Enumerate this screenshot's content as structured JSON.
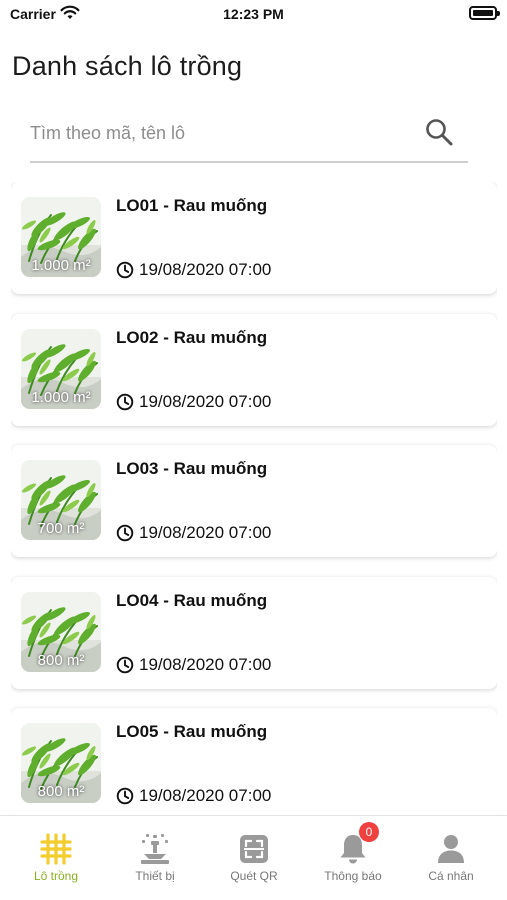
{
  "status_bar": {
    "carrier": "Carrier",
    "time": "12:23 PM"
  },
  "page": {
    "title": "Danh sách lô trồng"
  },
  "search": {
    "placeholder": "Tìm theo mã, tên lô",
    "value": ""
  },
  "plots": [
    {
      "title": "LO01 - Rau muống",
      "area": "1.000 m²",
      "date": "19/08/2020 07:00"
    },
    {
      "title": "LO02 - Rau muống",
      "area": "1.000 m²",
      "date": "19/08/2020 07:00"
    },
    {
      "title": "LO03 - Rau muống",
      "area": "700 m²",
      "date": "19/08/2020 07:00"
    },
    {
      "title": "LO04 - Rau muống",
      "area": "800 m²",
      "date": "19/08/2020 07:00"
    },
    {
      "title": "LO05 - Rau muống",
      "area": "800 m²",
      "date": "19/08/2020 07:00"
    }
  ],
  "tabbar": {
    "tabs": [
      {
        "label": "Lô trồng",
        "icon": "grid-fence-icon",
        "active": true
      },
      {
        "label": "Thiết bị",
        "icon": "sprinkler-icon",
        "active": false
      },
      {
        "label": "Quét QR",
        "icon": "qr-scan-icon",
        "active": false
      },
      {
        "label": "Thông báo",
        "icon": "bell-icon",
        "active": false,
        "badge": "0"
      },
      {
        "label": "Cá nhân",
        "icon": "person-icon",
        "active": false
      }
    ]
  },
  "colors": {
    "accent": "#87b21f",
    "badge": "#f04141",
    "inactive": "#777777"
  }
}
